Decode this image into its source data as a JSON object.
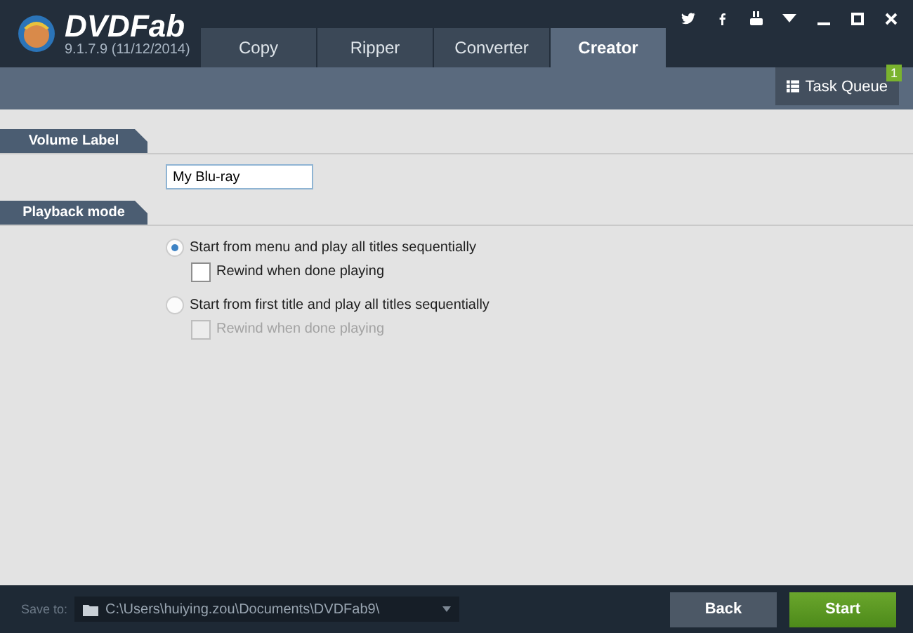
{
  "app": {
    "name": "DVDFab",
    "version": "9.1.7.9 (11/12/2014)"
  },
  "tabs": [
    {
      "label": "Copy",
      "selected": false
    },
    {
      "label": "Ripper",
      "selected": false
    },
    {
      "label": "Converter",
      "selected": false
    },
    {
      "label": "Creator",
      "selected": true
    }
  ],
  "task_queue": {
    "label": "Task Queue",
    "badge": "1"
  },
  "volume_label": {
    "heading": "Volume Label",
    "value": "My Blu-ray"
  },
  "playback_mode": {
    "heading": "Playback mode",
    "options": [
      {
        "label": "Start from menu and play all titles sequentially",
        "selected": true,
        "rewind": {
          "label": "Rewind when done playing",
          "checked": false,
          "disabled": false
        }
      },
      {
        "label": "Start from first title and play all titles sequentially",
        "selected": false,
        "rewind": {
          "label": "Rewind when done playing",
          "checked": false,
          "disabled": true
        }
      }
    ]
  },
  "footer": {
    "save_label": "Save to:",
    "path": "C:\\Users\\huiying.zou\\Documents\\DVDFab9\\",
    "buttons": [
      {
        "label": "Back",
        "kind": "secondary"
      },
      {
        "label": "Start",
        "kind": "primary"
      }
    ]
  }
}
